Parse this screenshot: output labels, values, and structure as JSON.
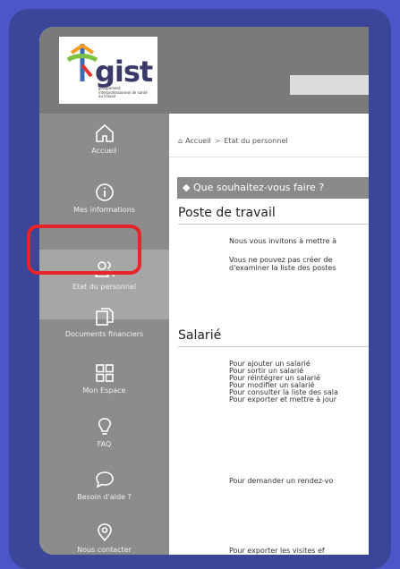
{
  "logo": {
    "word": "gist",
    "tagline": "groupement interprofessionnel de santé au travail"
  },
  "sidebar": {
    "items": [
      {
        "label": "Accueil",
        "icon": "home-icon"
      },
      {
        "label": "Mes informations",
        "icon": "info-icon"
      },
      {
        "label": "Etat du personnel",
        "icon": "users-icon"
      },
      {
        "label": "Documents financiers",
        "icon": "documents-icon"
      },
      {
        "label": "Mon Espace",
        "icon": "grid-icon"
      },
      {
        "label": "FAQ",
        "icon": "lightbulb-icon"
      },
      {
        "label": "Besoin d'aide ?",
        "icon": "chat-icon"
      },
      {
        "label": "Nous contacter",
        "icon": "location-icon"
      }
    ]
  },
  "breadcrumb": {
    "home": "Accueil",
    "sep": ">",
    "current": "Etat du personnel"
  },
  "panel": {
    "title": "Que souhaitez-vous faire ?"
  },
  "poste": {
    "title": "Poste de travail",
    "line1": "Nous vous invitons à mettre à",
    "line2": "Vous ne pouvez pas créer de",
    "line3": "d'examiner la liste des postes"
  },
  "salarie": {
    "title": "Salarié",
    "lines": [
      "Pour ajouter un salarié",
      "Pour sortir un salarié",
      "Pour réintégrer un salarié",
      "Pour modifier un salarié",
      "Pour consulter la liste des sala",
      "Pour exporter et mettre à jour"
    ],
    "rdv": "Pour demander un rendez-vo",
    "export": "Pour exporter les visites ef"
  },
  "colors": {
    "background": "#4b56c8",
    "frame": "#3b4698",
    "sidebar": "#8c8c8c",
    "highlight": "#e8232a"
  }
}
